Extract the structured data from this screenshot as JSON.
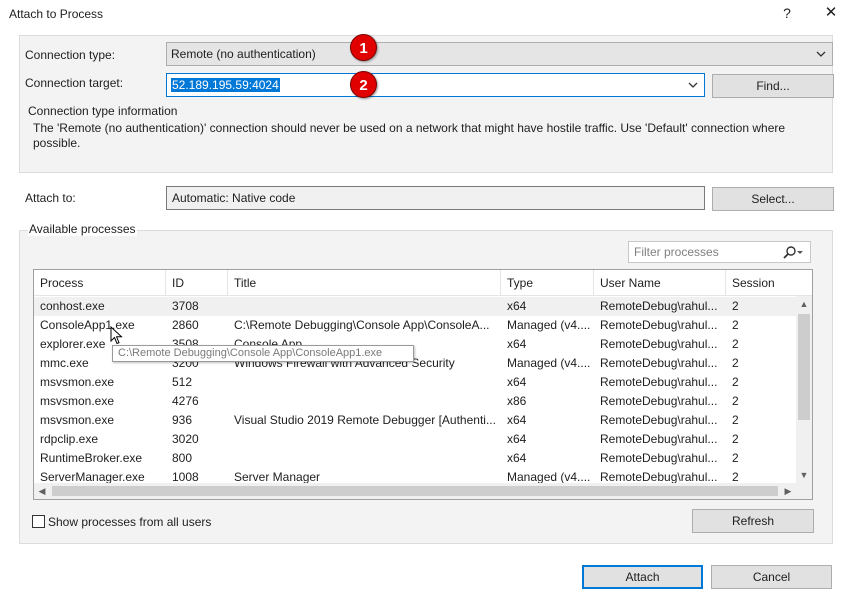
{
  "dialog": {
    "title": "Attach to Process",
    "help_glyph": "?",
    "close_glyph": "✕"
  },
  "connection": {
    "type_label": "Connection type:",
    "type_value": "Remote (no authentication)",
    "target_label": "Connection target:",
    "target_value": "52.189.195.59:4024",
    "find_label": "Find..."
  },
  "badges": [
    "1",
    "2"
  ],
  "info": {
    "heading": "Connection type information",
    "text": "The 'Remote (no authentication)' connection should never be used on a network that might have hostile traffic. Use 'Default' connection where possible."
  },
  "attach_to": {
    "label": "Attach to:",
    "value": "Automatic: Native code",
    "select_label": "Select..."
  },
  "processes": {
    "group_label": "Available processes",
    "filter_placeholder": "Filter processes",
    "columns": [
      "Process",
      "ID",
      "Title",
      "Type",
      "User Name",
      "Session"
    ],
    "rows": [
      [
        "conhost.exe",
        "3708",
        "",
        "x64",
        "RemoteDebug\\rahul...",
        "2"
      ],
      [
        "ConsoleApp1.exe",
        "2860",
        "C:\\Remote Debugging\\Console App\\ConsoleA...",
        "Managed (v4....",
        "RemoteDebug\\rahul...",
        "2"
      ],
      [
        "explorer.exe",
        "3508",
        "Console App",
        "x64",
        "RemoteDebug\\rahul...",
        "2"
      ],
      [
        "mmc.exe",
        "3200",
        "Windows Firewall with Advanced Security",
        "Managed (v4....",
        "RemoteDebug\\rahul...",
        "2"
      ],
      [
        "msvsmon.exe",
        "512",
        "",
        "x64",
        "RemoteDebug\\rahul...",
        "2"
      ],
      [
        "msvsmon.exe",
        "4276",
        "",
        "x86",
        "RemoteDebug\\rahul...",
        "2"
      ],
      [
        "msvsmon.exe",
        "936",
        "Visual Studio 2019 Remote Debugger [Authenti...",
        "x64",
        "RemoteDebug\\rahul...",
        "2"
      ],
      [
        "rdpclip.exe",
        "3020",
        "",
        "x64",
        "RemoteDebug\\rahul...",
        "2"
      ],
      [
        "RuntimeBroker.exe",
        "800",
        "",
        "x64",
        "RemoteDebug\\rahul...",
        "2"
      ],
      [
        "ServerManager.exe",
        "1008",
        "Server Manager",
        "Managed (v4....",
        "RemoteDebug\\rahul...",
        "2"
      ]
    ],
    "tooltip": "C:\\Remote Debugging\\Console App\\ConsoleApp1.exe",
    "show_all_label": "Show processes from all users",
    "refresh_label": "Refresh"
  },
  "footer": {
    "attach_label": "Attach",
    "cancel_label": "Cancel"
  },
  "colors": {
    "accent": "#0078d7",
    "badge": "#e00000"
  }
}
